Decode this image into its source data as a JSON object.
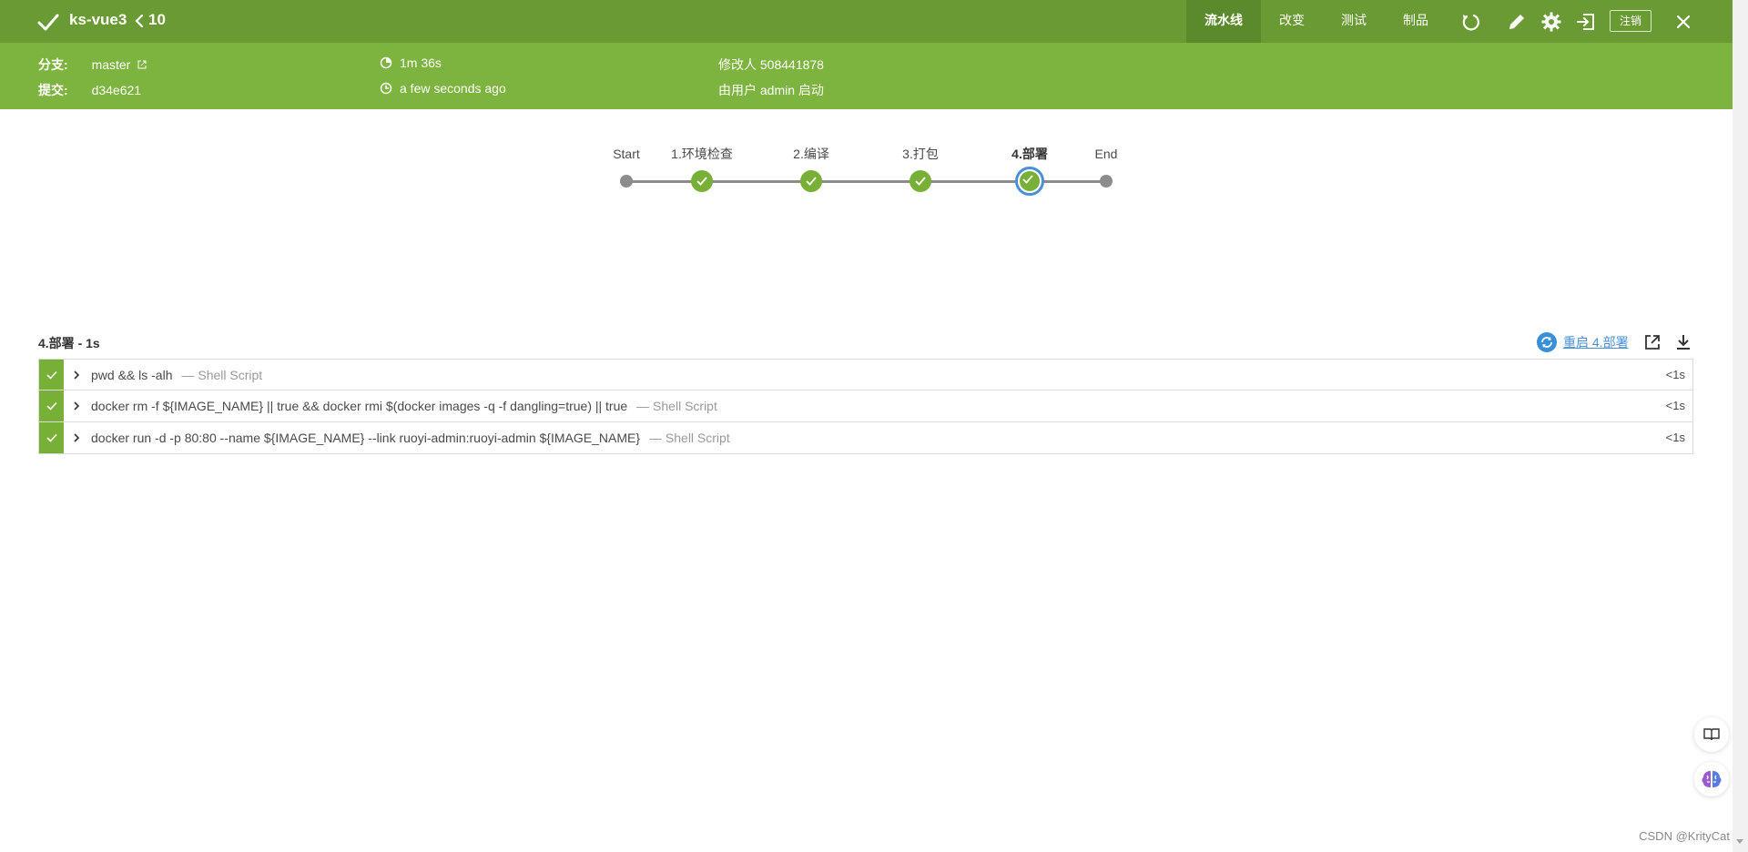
{
  "header": {
    "job_title": "ks-vue3",
    "run_number": "10",
    "tabs": [
      {
        "label": "流水线",
        "active": true
      },
      {
        "label": "改变",
        "active": false
      },
      {
        "label": "测试",
        "active": false
      },
      {
        "label": "制品",
        "active": false
      }
    ],
    "logout_label": "注销",
    "colors": {
      "top_bar": "#6a9a33",
      "info_bar": "#7db33f",
      "success": "#78b037",
      "link": "#4a90d9"
    }
  },
  "info": {
    "branch_label": "分支:",
    "branch_value": "master",
    "commit_label": "提交:",
    "commit_value": "d34e621",
    "duration": "1m 36s",
    "time_ago": "a few seconds ago",
    "changes_by": "修改人 508441878",
    "started_by": "由用户 admin 启动"
  },
  "pipeline": {
    "stages": [
      {
        "label": "Start",
        "status": "start"
      },
      {
        "label": "1.环境检查",
        "status": "success"
      },
      {
        "label": "2.编译",
        "status": "success"
      },
      {
        "label": "3.打包",
        "status": "success"
      },
      {
        "label": "4.部署",
        "status": "selected"
      },
      {
        "label": "End",
        "status": "end"
      }
    ]
  },
  "step_panel": {
    "title": "4.部署 - 1s",
    "restart_label": "重启 4.部署",
    "steps": [
      {
        "command": "pwd && ls -alh",
        "type": "— Shell Script",
        "duration": "<1s"
      },
      {
        "command": "docker rm -f ${IMAGE_NAME} || true && docker rmi $(docker images -q -f dangling=true) || true",
        "type": "— Shell Script",
        "duration": "<1s"
      },
      {
        "command": "docker run -d -p 80:80 --name ${IMAGE_NAME} --link ruoyi-admin:ruoyi-admin ${IMAGE_NAME}",
        "type": "— Shell Script",
        "duration": "<1s"
      }
    ]
  },
  "watermark": "CSDN @KrityCat"
}
